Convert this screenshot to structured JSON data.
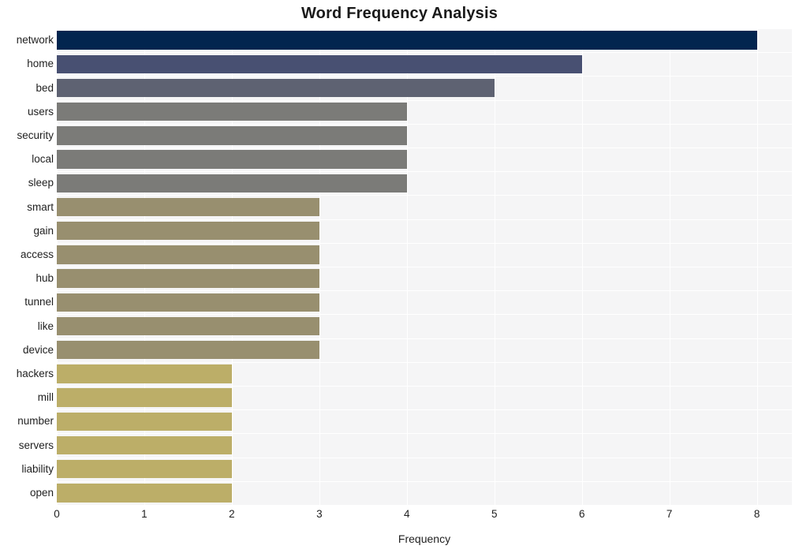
{
  "chart_data": {
    "type": "bar",
    "orientation": "horizontal",
    "title": "Word Frequency Analysis",
    "xlabel": "Frequency",
    "ylabel": "",
    "xlim": [
      0,
      8.4
    ],
    "ylim": [
      0,
      20
    ],
    "xticks": [
      0,
      1,
      2,
      3,
      4,
      5,
      6,
      7,
      8
    ],
    "xtick_labels": [
      "0",
      "1",
      "2",
      "3",
      "4",
      "5",
      "6",
      "7",
      "8"
    ],
    "grid": true,
    "grid_axis": "both",
    "grid_color": "#ffffff",
    "plot_background": "#f5f5f6",
    "figure_background": "#ffffff",
    "legend": null,
    "categories": [
      "network",
      "home",
      "bed",
      "users",
      "security",
      "local",
      "sleep",
      "smart",
      "gain",
      "access",
      "hub",
      "tunnel",
      "like",
      "device",
      "hackers",
      "mill",
      "number",
      "servers",
      "liability",
      "open"
    ],
    "values": [
      8,
      6,
      5,
      4,
      4,
      4,
      4,
      3,
      3,
      3,
      3,
      3,
      3,
      3,
      2,
      2,
      2,
      2,
      2,
      2
    ],
    "bar_colors": [
      "#02254f",
      "#485072",
      "#5e6272",
      "#7b7b78",
      "#7b7b78",
      "#7b7b78",
      "#7b7b78",
      "#988f6f",
      "#988f6f",
      "#988f6f",
      "#988f6f",
      "#988f6f",
      "#988f6f",
      "#988f6f",
      "#bcae68",
      "#bcae68",
      "#bcae68",
      "#bcae68",
      "#bcae68",
      "#bcae68"
    ],
    "colormap": "cividis"
  },
  "axis": {
    "x_title": "Frequency"
  },
  "title": {
    "text": "Word Frequency Analysis"
  }
}
